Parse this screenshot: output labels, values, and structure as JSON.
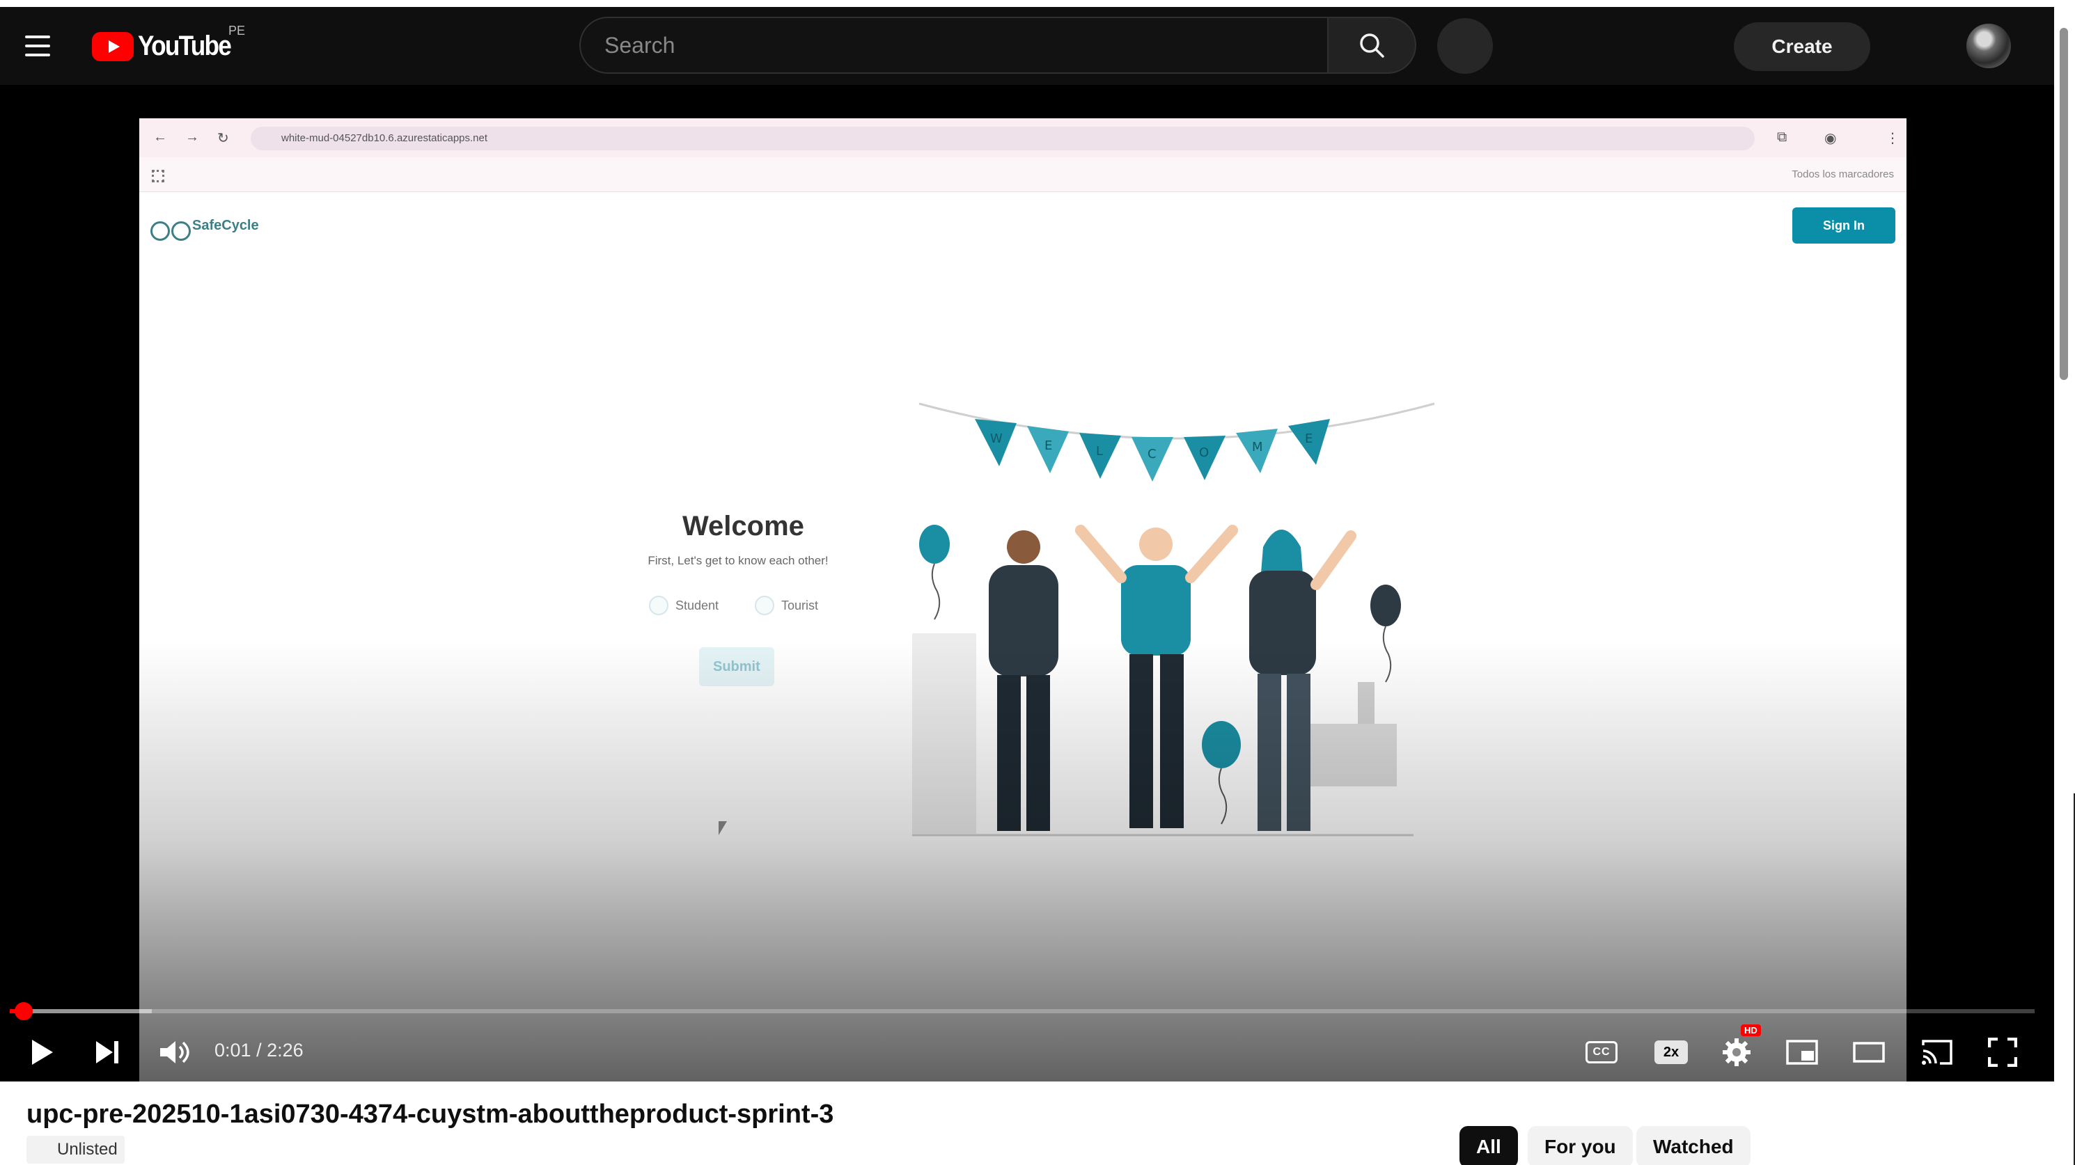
{
  "header": {
    "logo_text": "YouTube",
    "country_code": "PE",
    "search_placeholder": "Search",
    "create_label": "Create"
  },
  "video_frame": {
    "browser_url": "white-mud-04527db10.6.azurestaticapps.net",
    "bookmarks_label": "Todos los marcadores",
    "app_logo_text": "SafeCycle",
    "sign_in_label": "Sign In",
    "welcome_title": "Welcome",
    "welcome_subtitle": "First, Let's get to know each other!",
    "radio_options": [
      "Student",
      "Tourist"
    ],
    "submit_label": "Submit",
    "banner_letters": [
      "W",
      "E",
      "L",
      "C",
      "O",
      "M",
      "E"
    ]
  },
  "player": {
    "current_time": "0:01",
    "separator": " / ",
    "duration": "2:26",
    "played_fraction": 0.007,
    "buffered_fraction": 0.07,
    "cc_label": "CC",
    "speed_label": "2x",
    "hd_badge": "HD"
  },
  "video_info": {
    "title": "upc-pre-202510-1asi0730-4374-cuystm-abouttheproduct-sprint-3",
    "visibility": "Unlisted"
  },
  "filter_chips": [
    {
      "label": "All",
      "active": true
    },
    {
      "label": "For you",
      "active": false
    },
    {
      "label": "Watched",
      "active": false
    }
  ],
  "colors": {
    "brand_red": "#ff0000",
    "header_bg": "#0f0f0f",
    "app_accent": "#0b8fa8"
  }
}
